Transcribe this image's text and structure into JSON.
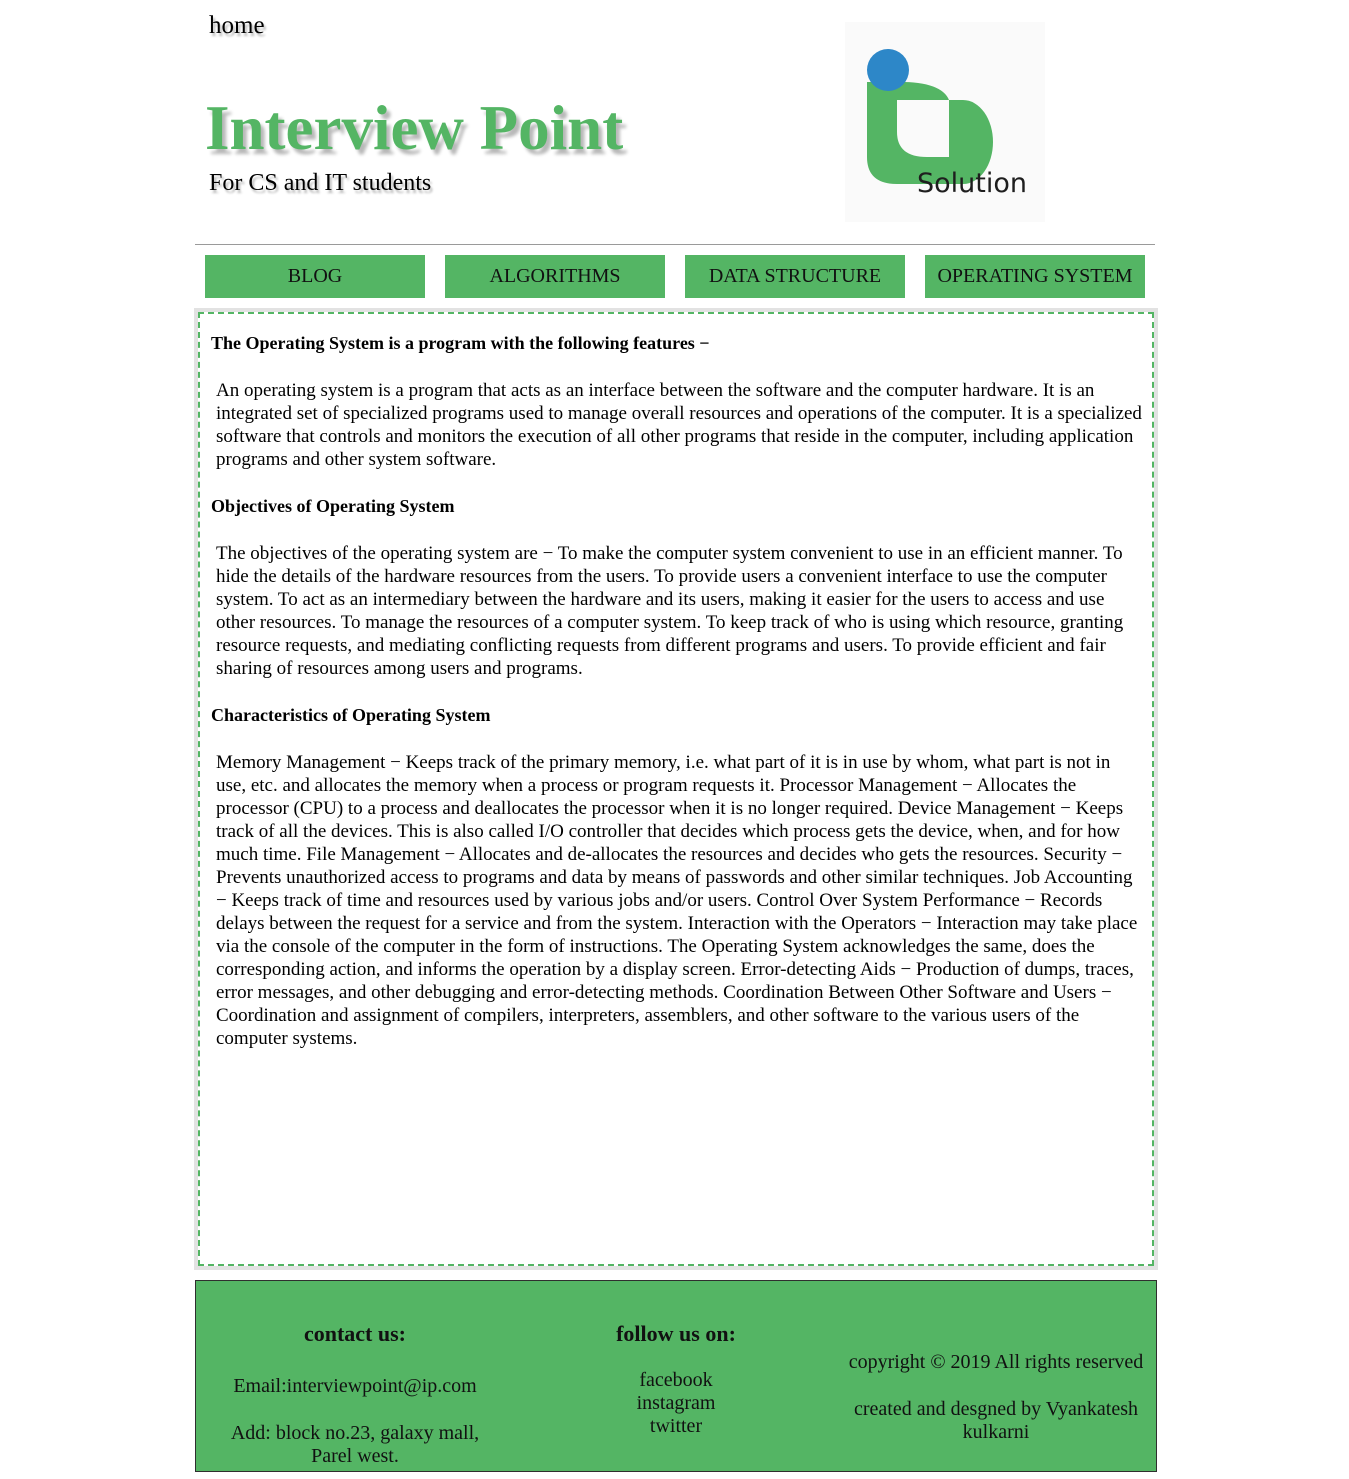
{
  "header": {
    "home_link": "home",
    "title": "Interview Point",
    "subtitle": "For CS and IT students",
    "logo_text": "Solution"
  },
  "colors": {
    "brand_green": "#54b564",
    "logo_blue": "#2d87c8",
    "content_border_gray": "#e2e2e2"
  },
  "nav": {
    "items": [
      "BLOG",
      "ALGORITHMS",
      "DATA STRUCTURE",
      "OPERATING SYSTEM"
    ]
  },
  "content": {
    "heading1": "The Operating System is a program with the following features −",
    "para1": "An operating system is a program that acts as an interface between the software and the computer hardware. It is an integrated set of specialized programs used to manage overall resources and operations of the computer. It is a specialized software that controls and monitors the execution of all other programs that reside in the computer, including application programs and other system software.",
    "heading2": "Objectives of Operating System",
    "para2": "The objectives of the operating system are − To make the computer system convenient to use in an efficient manner. To hide the details of the hardware resources from the users. To provide users a convenient interface to use the computer system. To act as an intermediary between the hardware and its users, making it easier for the users to access and use other resources. To manage the resources of a computer system. To keep track of who is using which resource, granting resource requests, and mediating conflicting requests from different programs and users. To provide efficient and fair sharing of resources among users and programs.",
    "heading3": "Characteristics of Operating System",
    "para3": "Memory Management − Keeps track of the primary memory, i.e. what part of it is in use by whom, what part is not in use, etc. and allocates the memory when a process or program requests it. Processor Management − Allocates the processor (CPU) to a process and deallocates the processor when it is no longer required. Device Management − Keeps track of all the devices. This is also called I/O controller that decides which process gets the device, when, and for how much time. File Management − Allocates and de-allocates the resources and decides who gets the resources. Security − Prevents unauthorized access to programs and data by means of passwords and other similar techniques. Job Accounting − Keeps track of time and resources used by various jobs and/or users. Control Over System Performance − Records delays between the request for a service and from the system. Interaction with the Operators − Interaction may take place via the console of the computer in the form of instructions. The Operating System acknowledges the same, does the corresponding action, and informs the operation by a display screen. Error-detecting Aids − Production of dumps, traces, error messages, and other debugging and error-detecting methods. Coordination Between Other Software and Users − Coordination and assignment of compilers, interpreters, assemblers, and other software to the various users of the computer systems."
  },
  "footer": {
    "contact_heading": "contact us:",
    "email": "Email:interviewpoint@ip.com",
    "address": "Add: block no.23, galaxy mall, Parel west.",
    "follow_heading": "follow us on:",
    "social": [
      "facebook",
      "instagram",
      "twitter"
    ],
    "copyright": "copyright © 2019 All rights reserved",
    "credit": "created and desgned by Vyankatesh kulkarni"
  }
}
